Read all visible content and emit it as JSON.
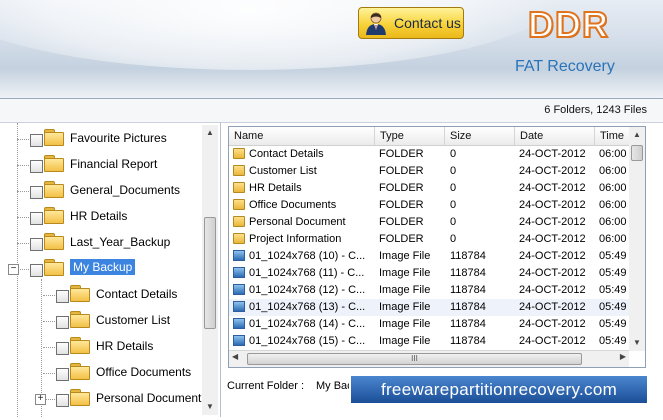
{
  "header": {
    "contact_label": "Contact us",
    "brand": "DDR",
    "product": "FAT Recovery"
  },
  "status": {
    "file_count": "6 Folders,  1243 Files"
  },
  "tree": {
    "items": [
      {
        "label": "Favourite Pictures"
      },
      {
        "label": "Financial Report"
      },
      {
        "label": "General_Documents"
      },
      {
        "label": "HR Details"
      },
      {
        "label": "Last_Year_Backup"
      },
      {
        "label": "My Backup",
        "selected": true,
        "expander": "−"
      },
      {
        "label": "Contact Details"
      },
      {
        "label": "Customer List"
      },
      {
        "label": "HR Details"
      },
      {
        "label": "Office Documents"
      },
      {
        "label": "Personal Document",
        "expander": "+"
      }
    ]
  },
  "list": {
    "columns": [
      "Name",
      "Type",
      "Size",
      "Date",
      "Time"
    ],
    "rows": [
      {
        "name": "Contact Details",
        "type": "FOLDER",
        "size": "0",
        "date": "24-OCT-2012",
        "time": "06:00",
        "icon": "folder-icon"
      },
      {
        "name": "Customer List",
        "type": "FOLDER",
        "size": "0",
        "date": "24-OCT-2012",
        "time": "06:00",
        "icon": "folder-icon"
      },
      {
        "name": "HR Details",
        "type": "FOLDER",
        "size": "0",
        "date": "24-OCT-2012",
        "time": "06:00",
        "icon": "folder-icon"
      },
      {
        "name": "Office Documents",
        "type": "FOLDER",
        "size": "0",
        "date": "24-OCT-2012",
        "time": "06:00",
        "icon": "folder-icon"
      },
      {
        "name": "Personal Document",
        "type": "FOLDER",
        "size": "0",
        "date": "24-OCT-2012",
        "time": "06:00",
        "icon": "folder-icon"
      },
      {
        "name": "Project Information",
        "type": "FOLDER",
        "size": "0",
        "date": "24-OCT-2012",
        "time": "06:00",
        "icon": "folder-icon"
      },
      {
        "name": "01_1024x768 (10) - C...",
        "type": "Image File",
        "size": "118784",
        "date": "24-OCT-2012",
        "time": "05:49",
        "icon": "image-file-icon"
      },
      {
        "name": "01_1024x768 (11) - C...",
        "type": "Image File",
        "size": "118784",
        "date": "24-OCT-2012",
        "time": "05:49",
        "icon": "image-file-icon"
      },
      {
        "name": "01_1024x768 (12) - C...",
        "type": "Image File",
        "size": "118784",
        "date": "24-OCT-2012",
        "time": "05:49",
        "icon": "image-file-icon"
      },
      {
        "name": "01_1024x768 (13) - C...",
        "type": "Image File",
        "size": "118784",
        "date": "24-OCT-2012",
        "time": "05:49",
        "icon": "image-file-icon",
        "highlight": true
      },
      {
        "name": "01_1024x768 (14) - C...",
        "type": "Image File",
        "size": "118784",
        "date": "24-OCT-2012",
        "time": "05:49",
        "icon": "image-file-icon"
      },
      {
        "name": "01_1024x768 (15) - C...",
        "type": "Image File",
        "size": "118784",
        "date": "24-OCT-2012",
        "time": "05:49",
        "icon": "image-file-icon"
      }
    ],
    "hscroll_grip": "III"
  },
  "footer": {
    "current_label": "Current Folder :",
    "current_value": "My Bac",
    "watermark": "freewarepartitionrecovery.com"
  },
  "colors": {
    "selection": "#3b84e0",
    "brand_stroke": "#e0741d",
    "product_text": "#2a73b8",
    "watermark_bg": "#1b4f97"
  }
}
